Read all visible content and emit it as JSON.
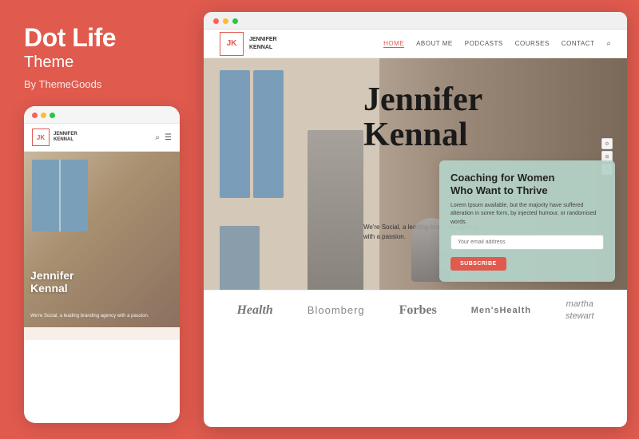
{
  "leftPanel": {
    "title": "Dot Life",
    "subtitle": "Theme",
    "by": "By ThemeGoods"
  },
  "mobileBrowser": {
    "dots": [
      "red",
      "yellow",
      "green"
    ]
  },
  "mobileNav": {
    "logo": "JK",
    "logoLine1": "JENNIFER",
    "logoLine2": "KENNAL"
  },
  "mobileHero": {
    "name": "Jennifer\nKennal",
    "desc": "We're Social, a leading branding agency with a passion."
  },
  "desktopNav": {
    "logo": "JK",
    "logoLine1": "JENNIFER",
    "logoLine2": "KENNAL",
    "links": [
      "HOME",
      "ABOUT ME",
      "PODCASTS",
      "COURSES",
      "CONTACT"
    ],
    "activeLink": "HOME"
  },
  "desktopHero": {
    "title": "Jennifer\nKennal",
    "subtitle": "We're Social, a leading branding agency with a passion."
  },
  "coachingCard": {
    "title": "Coaching for Women\nWho Want to Thrive",
    "desc": "Lorem Ipsum available, but the majority have suffered alteration in some form, by injected humour, or randomised words.",
    "inputPlaceholder": "Your email address",
    "buttonLabel": "SUBSCRIBE"
  },
  "brands": [
    {
      "name": "Health",
      "style": "health"
    },
    {
      "name": "Bloomberg",
      "style": "bloomberg"
    },
    {
      "name": "Forbes",
      "style": "forbes"
    },
    {
      "name": "Men'sHealth",
      "style": "menshealth"
    },
    {
      "name": "martha\nstewart",
      "style": "martha"
    }
  ]
}
